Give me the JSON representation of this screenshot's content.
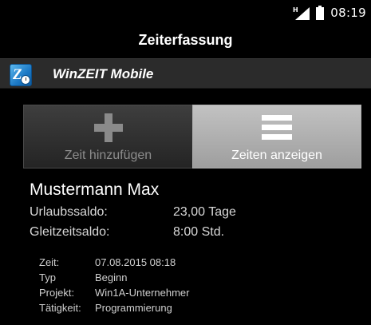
{
  "status_bar": {
    "signal_icon": "signal-h-icon",
    "battery_icon": "battery-icon",
    "time": "08:19"
  },
  "title": "Zeiterfassung",
  "app_header": {
    "logo_icon": "winzeit-logo-icon",
    "name": "WinZEIT Mobile"
  },
  "actions": {
    "add": {
      "icon": "plus-icon",
      "label": "Zeit hinzufügen"
    },
    "show": {
      "icon": "list-icon",
      "label": "Zeiten anzeigen"
    }
  },
  "person": {
    "name": "Mustermann Max",
    "urlaubssaldo_label": "Urlaubssaldo:",
    "urlaubssaldo_value": "23,00 Tage",
    "gleitzeitsaldo_label": "Gleitzeitsaldo:",
    "gleitzeitsaldo_value": "8:00 Std."
  },
  "last_entry": [
    {
      "label": "Zeit:",
      "value": "07.08.2015 08:18"
    },
    {
      "label": "Typ",
      "value": "Beginn"
    },
    {
      "label": "Projekt:",
      "value": "Win1A-Unternehmer"
    },
    {
      "label": "Tätigkeit:",
      "value": "Programmierung"
    }
  ],
  "colors": {
    "background": "#000000",
    "header_bar": "#2b2b2b",
    "button_dark": "#303030",
    "button_light": "#b4b4b4",
    "logo_blue": "#1b78c4"
  }
}
